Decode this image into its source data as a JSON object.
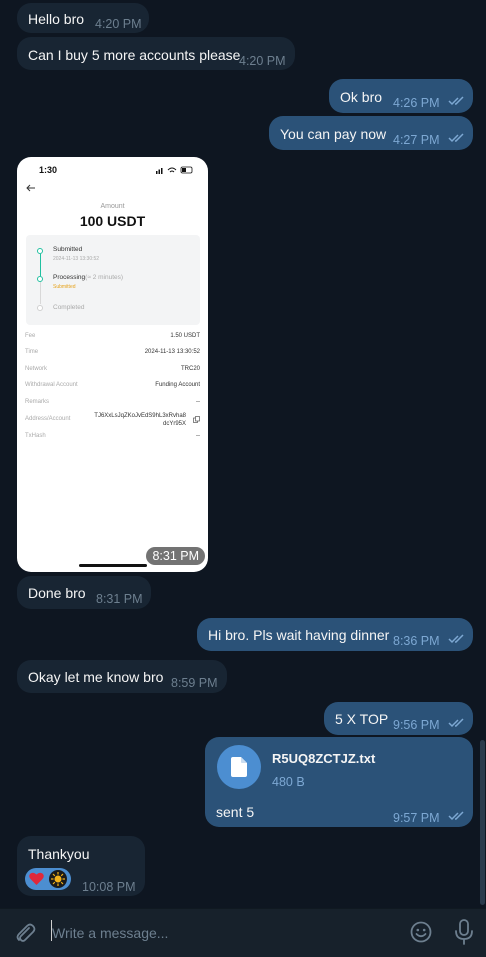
{
  "messages": [
    {
      "direction": "in",
      "text": "Hello bro",
      "time": "4:20 PM"
    },
    {
      "direction": "in",
      "text": "Can I buy 5 more accounts please",
      "time": "4:20 PM"
    },
    {
      "direction": "out",
      "text": "Ok bro",
      "time": "4:26 PM",
      "status": "read"
    },
    {
      "direction": "out",
      "text": "You can pay now",
      "time": "4:27 PM",
      "status": "read"
    },
    {
      "direction": "in",
      "type": "photo",
      "time": "8:31 PM"
    },
    {
      "direction": "in",
      "text": "Done bro",
      "time": "8:31 PM"
    },
    {
      "direction": "out",
      "text": "Hi bro. Pls wait having dinner",
      "time": "8:36 PM",
      "status": "read"
    },
    {
      "direction": "in",
      "text": "Okay let me know bro",
      "time": "8:59 PM"
    },
    {
      "direction": "out",
      "text": "5 X TOP",
      "time": "9:56 PM",
      "status": "read"
    },
    {
      "direction": "out",
      "type": "file",
      "file_name": "R5UQ8ZCTJZ.txt",
      "file_size": "480 B",
      "text": "sent 5",
      "time": "9:57 PM",
      "status": "read"
    },
    {
      "direction": "in",
      "text": "Thankyou",
      "time": "10:08 PM",
      "reactions": [
        "heart-icon",
        "sun-avatar-icon"
      ]
    }
  ],
  "screenshot": {
    "status_time": "1:30",
    "amount_label": "Amount",
    "amount": "100 USDT",
    "steps": [
      {
        "title": "Submitted",
        "sub": "2024-11-13 13:30:52"
      },
      {
        "title": "Processing",
        "note": "(≈ 2 minutes)",
        "sub": "Submitted"
      },
      {
        "title": "Completed"
      }
    ],
    "rows": [
      {
        "key": "Fee",
        "value": "1.50 USDT"
      },
      {
        "key": "Time",
        "value": "2024-11-13 13:30:52"
      },
      {
        "key": "Network",
        "value": "TRC20"
      },
      {
        "key": "Withdrawal Account",
        "value": "Funding Account"
      },
      {
        "key": "Remarks",
        "value": "--"
      },
      {
        "key": "Address/Account",
        "value_line1": "TJ6XxLsJqZKoJvEdS9hL3xRvha8",
        "value_line2": "dcYr95X"
      },
      {
        "key": "TxHash",
        "value": "--"
      }
    ]
  },
  "composer": {
    "placeholder": "Write a message..."
  },
  "colors": {
    "background": "#0e1621",
    "incoming": "#182533",
    "outgoing": "#2b5278",
    "accent": "#4c8ed1"
  }
}
